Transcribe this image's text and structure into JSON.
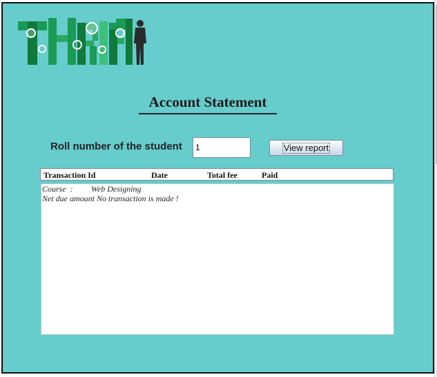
{
  "logo": {
    "icon": "thrift-logo-with-silhouette",
    "text": "THRIFT",
    "colors": {
      "green_dark": "#0f7a3b",
      "green_mid": "#1a9a55",
      "green_light": "#3fbf7a",
      "silhouette": "#2b2b2b"
    }
  },
  "page": {
    "title": "Account Statement",
    "background": "#66cccc"
  },
  "form": {
    "roll_label": "Roll number of the student",
    "roll_value": "1",
    "view_button": "View report"
  },
  "table": {
    "columns": [
      "Transaction Id",
      "Date",
      "Total fee",
      "Paid"
    ]
  },
  "report": {
    "course_label": "Course  :",
    "course_value": "Web Designing",
    "message": "Net due amount No transaction is made !"
  }
}
